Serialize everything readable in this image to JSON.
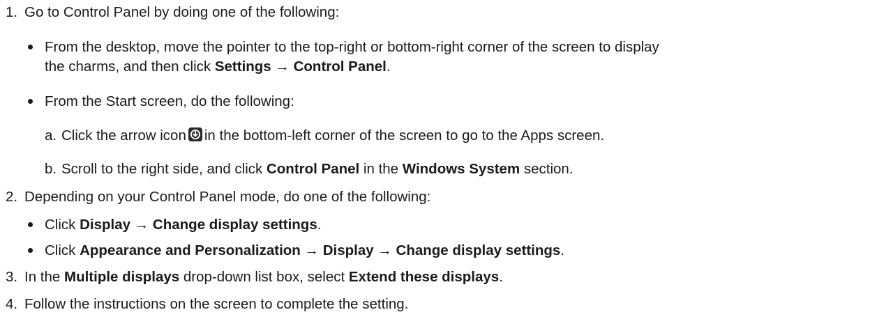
{
  "steps": [
    {
      "number": "1.",
      "text": "Go to Control Panel by doing one of the following:",
      "bullets": [
        {
          "line1": "From the desktop, move the pointer to the top-right or bottom-right corner of the screen to display",
          "line2_pre": "the charms, and then click ",
          "line2_bold": "Settings → Control Panel",
          "line2_post": "."
        },
        {
          "text": "From the Start screen, do the following:",
          "substeps": [
            {
              "letter": "a.",
              "pre": "Click the arrow icon",
              "icon": "down-arrow-circle-icon",
              "post": "in the bottom-left corner of the screen to go to the Apps screen."
            },
            {
              "letter": "b.",
              "pre": "Scroll to the right side, and click ",
              "bold1": "Control Panel",
              "mid": " in the ",
              "bold2": "Windows System",
              "post": " section."
            }
          ]
        }
      ]
    },
    {
      "number": "2.",
      "text": "Depending on your Control Panel mode, do one of the following:",
      "bullets": [
        {
          "pre": "Click ",
          "bold": "Display → Change display settings",
          "post": "."
        },
        {
          "pre": "Click ",
          "bold": "Appearance and Personalization → Display → Change display settings",
          "post": "."
        }
      ]
    },
    {
      "number": "3.",
      "pre": "In the ",
      "bold1": "Multiple displays",
      "mid": " drop-down list box, select ",
      "bold2": "Extend these displays",
      "post": "."
    },
    {
      "number": "4.",
      "text": "Follow the instructions on the screen to complete the setting."
    }
  ]
}
